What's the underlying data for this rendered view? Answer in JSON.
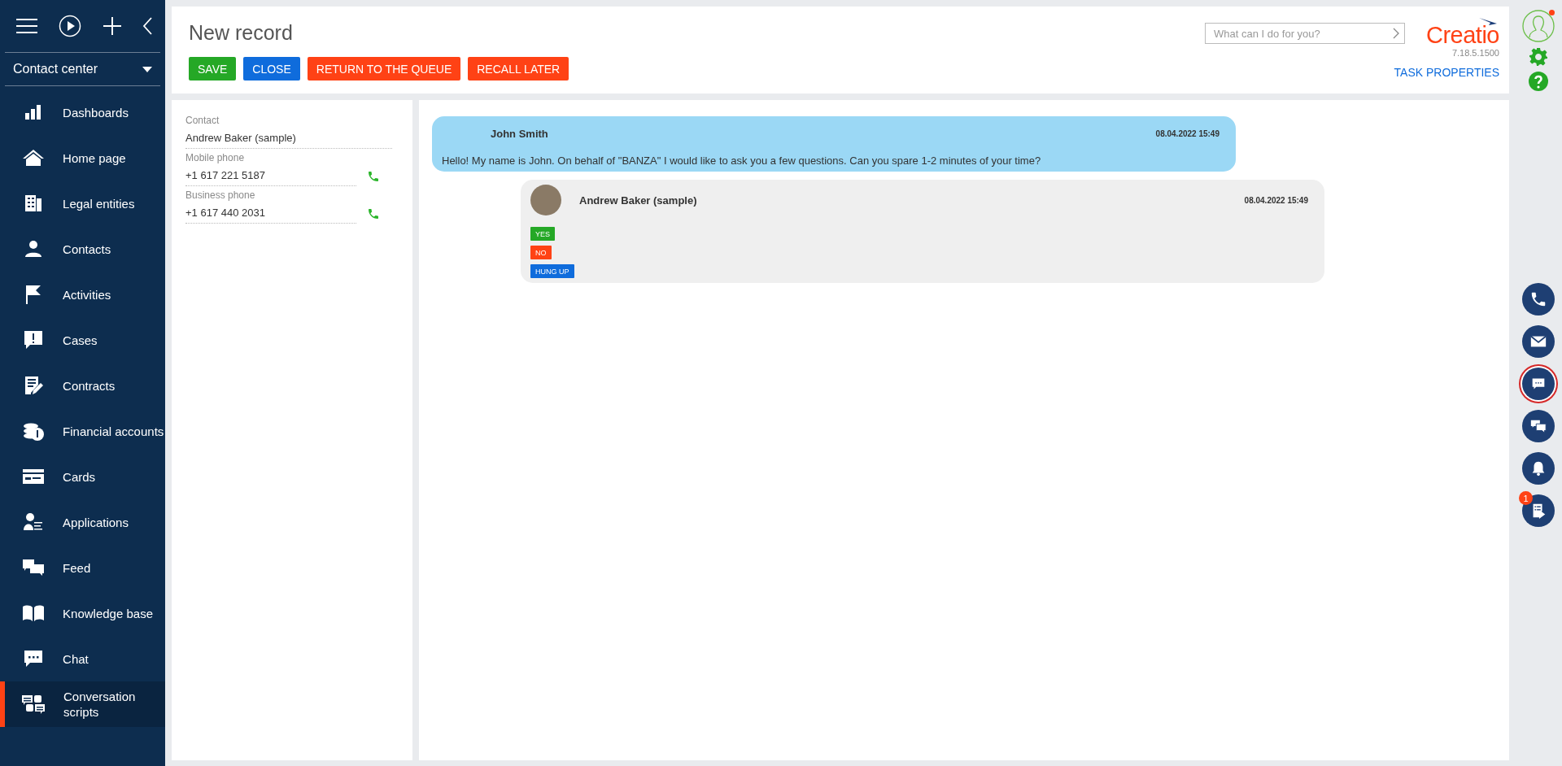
{
  "sidebar": {
    "workplace": "Contact center",
    "items": [
      {
        "label": "Dashboards",
        "selected": false
      },
      {
        "label": "Home page",
        "selected": false
      },
      {
        "label": "Legal entities",
        "selected": false
      },
      {
        "label": "Contacts",
        "selected": false
      },
      {
        "label": "Activities",
        "selected": false
      },
      {
        "label": "Cases",
        "selected": false
      },
      {
        "label": "Contracts",
        "selected": false
      },
      {
        "label": "Financial accounts",
        "selected": false
      },
      {
        "label": "Cards",
        "selected": false
      },
      {
        "label": "Applications",
        "selected": false
      },
      {
        "label": "Feed",
        "selected": false
      },
      {
        "label": "Knowledge base",
        "selected": false
      },
      {
        "label": "Chat",
        "selected": false
      },
      {
        "label": "Conversation scripts",
        "selected": true
      }
    ]
  },
  "header": {
    "title": "New record",
    "buttons": [
      {
        "label": "SAVE",
        "color": "#25a826"
      },
      {
        "label": "CLOSE",
        "color": "#0f6cdc"
      },
      {
        "label": "RETURN TO THE QUEUE",
        "color": "#ff4215"
      },
      {
        "label": "RECALL LATER",
        "color": "#ff4215"
      }
    ],
    "search": {
      "placeholder": "What can I do for you?"
    },
    "logo": "Creatio",
    "version": "7.18.5.1500",
    "link": "TASK PROPERTIES"
  },
  "contact": {
    "fields": [
      {
        "label": "Contact",
        "value": "Andrew Baker (sample)",
        "kind": "text"
      },
      {
        "label": "Mobile phone",
        "value": "+1 617 221 5187",
        "kind": "phone"
      },
      {
        "label": "Business phone",
        "value": "+1 617 440 2031",
        "kind": "phone"
      }
    ]
  },
  "chat": {
    "messages": [
      {
        "kind": "operator",
        "author": "John Smith",
        "time": "08.04.2022 15:49",
        "text": "Hello! My name is John. On behalf of \"BANZA\" I would like to ask you a few questions. Can you spare 1-2 minutes of your time?"
      },
      {
        "kind": "contact",
        "author": "Andrew Baker (sample)",
        "time": "08.04.2022 15:49",
        "answers": [
          {
            "label": "YES",
            "color": "#25a826"
          },
          {
            "label": "NO",
            "color": "#ff4215"
          },
          {
            "label": "HUNG UP",
            "color": "#0f6cdc"
          }
        ]
      }
    ]
  },
  "rail": {
    "items": [
      {
        "selected": false
      },
      {
        "selected": false
      },
      {
        "selected": true
      },
      {
        "selected": false
      },
      {
        "selected": false
      },
      {
        "selected": false,
        "badge": "1"
      }
    ]
  }
}
